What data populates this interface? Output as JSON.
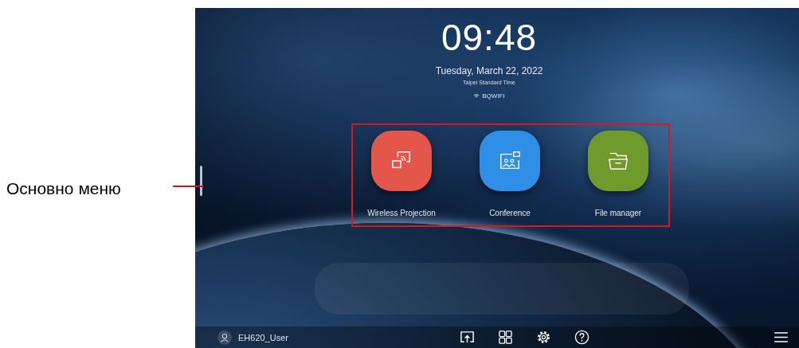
{
  "annotation": {
    "label": "Основно меню"
  },
  "clock": {
    "time": "09:48",
    "date": "Tuesday, March 22, 2022",
    "timezone": "Taipei Standard Time",
    "network": "BQWIFI"
  },
  "apps": [
    {
      "label": "Wireless Projection",
      "color": "#e5564a",
      "kind": "projection"
    },
    {
      "label": "Conference",
      "color": "#2f8fe6",
      "kind": "conference"
    },
    {
      "label": "File manager",
      "color": "#6f9a2c",
      "kind": "files"
    }
  ],
  "user": {
    "name": "EH620_User"
  },
  "toolbar": [
    {
      "kind": "share"
    },
    {
      "kind": "apps"
    },
    {
      "kind": "settings"
    },
    {
      "kind": "help"
    }
  ]
}
